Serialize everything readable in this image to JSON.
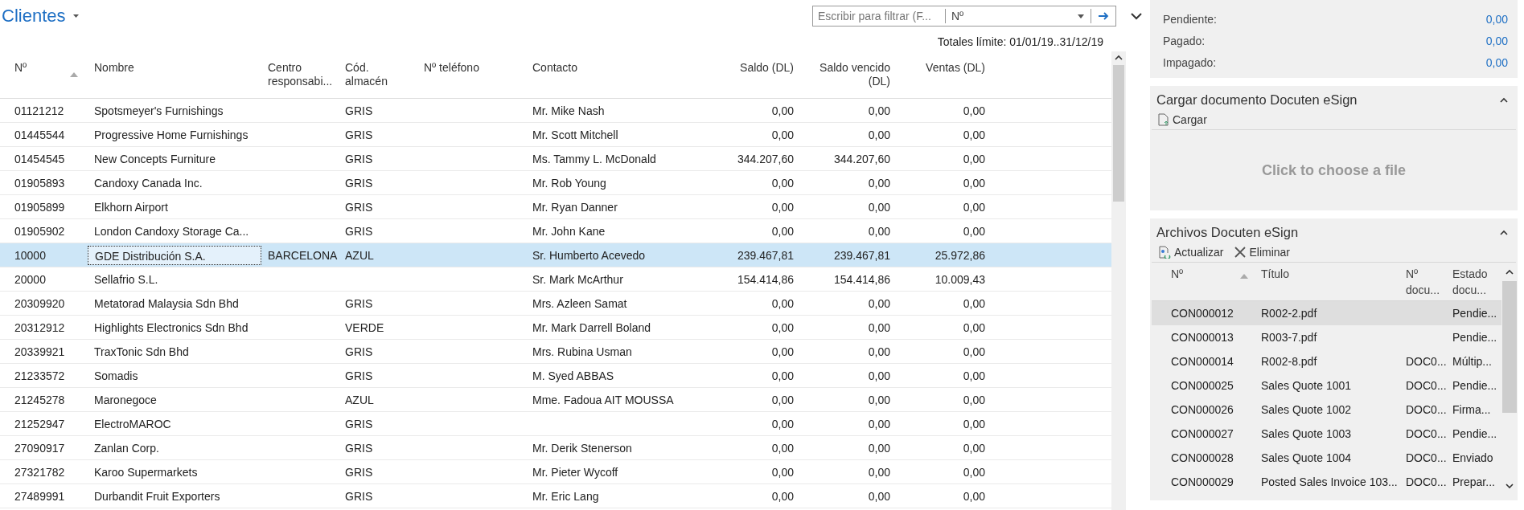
{
  "page": {
    "title": "Clientes",
    "filter": {
      "placeholder": "Escribir para filtrar (F...",
      "field": "Nº"
    },
    "totals": "Totales límite: 01/01/19..31/12/19"
  },
  "table": {
    "columns": [
      {
        "label": "Nº",
        "kind": "text",
        "sorted": true
      },
      {
        "label": "Nombre",
        "kind": "text",
        "sorted": false
      },
      {
        "label": "Centro responsabi...",
        "kind": "text",
        "sorted": false
      },
      {
        "label": "Cód. almacén",
        "kind": "text",
        "sorted": false
      },
      {
        "label": "Nº teléfono",
        "kind": "text",
        "sorted": false
      },
      {
        "label": "Contacto",
        "kind": "text",
        "sorted": false
      },
      {
        "label": "Saldo (DL)",
        "kind": "amount",
        "sorted": false
      },
      {
        "label": "Saldo vencido (DL)",
        "kind": "amount",
        "sorted": false
      },
      {
        "label": "Ventas (DL)",
        "kind": "amount",
        "sorted": false
      }
    ],
    "rows": [
      {
        "selected": false,
        "cells": [
          "01121212",
          "Spotsmeyer's Furnishings",
          "",
          "GRIS",
          "",
          "Mr. Mike Nash",
          "0,00",
          "0,00",
          "0,00"
        ]
      },
      {
        "selected": false,
        "cells": [
          "01445544",
          "Progressive Home Furnishings",
          "",
          "GRIS",
          "",
          "Mr. Scott Mitchell",
          "0,00",
          "0,00",
          "0,00"
        ]
      },
      {
        "selected": false,
        "cells": [
          "01454545",
          "New Concepts Furniture",
          "",
          "GRIS",
          "",
          "Ms. Tammy L. McDonald",
          "344.207,60",
          "344.207,60",
          "0,00"
        ]
      },
      {
        "selected": false,
        "cells": [
          "01905893",
          "Candoxy Canada Inc.",
          "",
          "GRIS",
          "",
          "Mr. Rob Young",
          "0,00",
          "0,00",
          "0,00"
        ]
      },
      {
        "selected": false,
        "cells": [
          "01905899",
          "Elkhorn Airport",
          "",
          "GRIS",
          "",
          "Mr. Ryan Danner",
          "0,00",
          "0,00",
          "0,00"
        ]
      },
      {
        "selected": false,
        "cells": [
          "01905902",
          "London Candoxy Storage Ca...",
          "",
          "GRIS",
          "",
          "Mr. John Kane",
          "0,00",
          "0,00",
          "0,00"
        ]
      },
      {
        "selected": true,
        "cells": [
          "10000",
          "GDE Distribución S.A.",
          "BARCELONA",
          "AZUL",
          "",
          "Sr. Humberto Acevedo",
          "239.467,81",
          "239.467,81",
          "25.972,86"
        ]
      },
      {
        "selected": false,
        "cells": [
          "20000",
          "Sellafrio S.L.",
          "",
          "",
          "",
          "Sr. Mark McArthur",
          "154.414,86",
          "154.414,86",
          "10.009,43"
        ]
      },
      {
        "selected": false,
        "cells": [
          "20309920",
          "Metatorad Malaysia Sdn Bhd",
          "",
          "GRIS",
          "",
          "Mrs. Azleen Samat",
          "0,00",
          "0,00",
          "0,00"
        ]
      },
      {
        "selected": false,
        "cells": [
          "20312912",
          "Highlights Electronics Sdn Bhd",
          "",
          "VERDE",
          "",
          "Mr. Mark Darrell Boland",
          "0,00",
          "0,00",
          "0,00"
        ]
      },
      {
        "selected": false,
        "cells": [
          "20339921",
          "TraxTonic Sdn Bhd",
          "",
          "GRIS",
          "",
          "Mrs. Rubina Usman",
          "0,00",
          "0,00",
          "0,00"
        ]
      },
      {
        "selected": false,
        "cells": [
          "21233572",
          "Somadis",
          "",
          "GRIS",
          "",
          "M. Syed ABBAS",
          "0,00",
          "0,00",
          "0,00"
        ]
      },
      {
        "selected": false,
        "cells": [
          "21245278",
          "Maronegoce",
          "",
          "AZUL",
          "",
          "Mme. Fadoua AIT MOUSSA",
          "0,00",
          "0,00",
          "0,00"
        ]
      },
      {
        "selected": false,
        "cells": [
          "21252947",
          "ElectroMAROC",
          "",
          "GRIS",
          "",
          "",
          "0,00",
          "0,00",
          "0,00"
        ]
      },
      {
        "selected": false,
        "cells": [
          "27090917",
          "Zanlan Corp.",
          "",
          "GRIS",
          "",
          "Mr. Derik Stenerson",
          "0,00",
          "0,00",
          "0,00"
        ]
      },
      {
        "selected": false,
        "cells": [
          "27321782",
          "Karoo Supermarkets",
          "",
          "GRIS",
          "",
          "Mr. Pieter Wycoff",
          "0,00",
          "0,00",
          "0,00"
        ]
      },
      {
        "selected": false,
        "cells": [
          "27489991",
          "Durbandit Fruit Exporters",
          "",
          "GRIS",
          "",
          "Mr. Eric Lang",
          "0,00",
          "0,00",
          "0,00"
        ]
      }
    ]
  },
  "side": {
    "summary": [
      {
        "label": "Pendiente:",
        "value": "0,00"
      },
      {
        "label": "Pagado:",
        "value": "0,00"
      },
      {
        "label": "Impagado:",
        "value": "0,00"
      }
    ],
    "upload": {
      "title": "Cargar documento Docuten eSign",
      "action": "Cargar",
      "dropzone": "Click to choose a file"
    },
    "files": {
      "title": "Archivos Docuten eSign",
      "actions": [
        {
          "kind": "refresh",
          "label": "Actualizar"
        },
        {
          "kind": "delete",
          "label": "Eliminar"
        }
      ],
      "columns": [
        {
          "label": "Nº",
          "sorted": true
        },
        {
          "label": "Título",
          "sorted": false
        },
        {
          "label": "Nº docu...",
          "sorted": false
        },
        {
          "label": "Estado docu...",
          "sorted": false
        }
      ],
      "rows": [
        {
          "selected": true,
          "cells": [
            "CON000012",
            "R002-2.pdf",
            "",
            "Pendie..."
          ]
        },
        {
          "selected": false,
          "cells": [
            "CON000013",
            "R003-7.pdf",
            "",
            "Pendie..."
          ]
        },
        {
          "selected": false,
          "cells": [
            "CON000014",
            "R002-8.pdf",
            "DOC0...",
            "Múltip..."
          ]
        },
        {
          "selected": false,
          "cells": [
            "CON000025",
            "Sales Quote 1001",
            "DOC0...",
            "Pendie..."
          ]
        },
        {
          "selected": false,
          "cells": [
            "CON000026",
            "Sales Quote 1002",
            "DOC0...",
            "Firma..."
          ]
        },
        {
          "selected": false,
          "cells": [
            "CON000027",
            "Sales Quote 1003",
            "DOC0...",
            "Pendie..."
          ]
        },
        {
          "selected": false,
          "cells": [
            "CON000028",
            "Sales Quote 1004",
            "DOC0...",
            "Enviado"
          ]
        },
        {
          "selected": false,
          "cells": [
            "CON000029",
            "Posted Sales Invoice 103...",
            "DOC0...",
            "Prepar..."
          ]
        }
      ]
    }
  }
}
